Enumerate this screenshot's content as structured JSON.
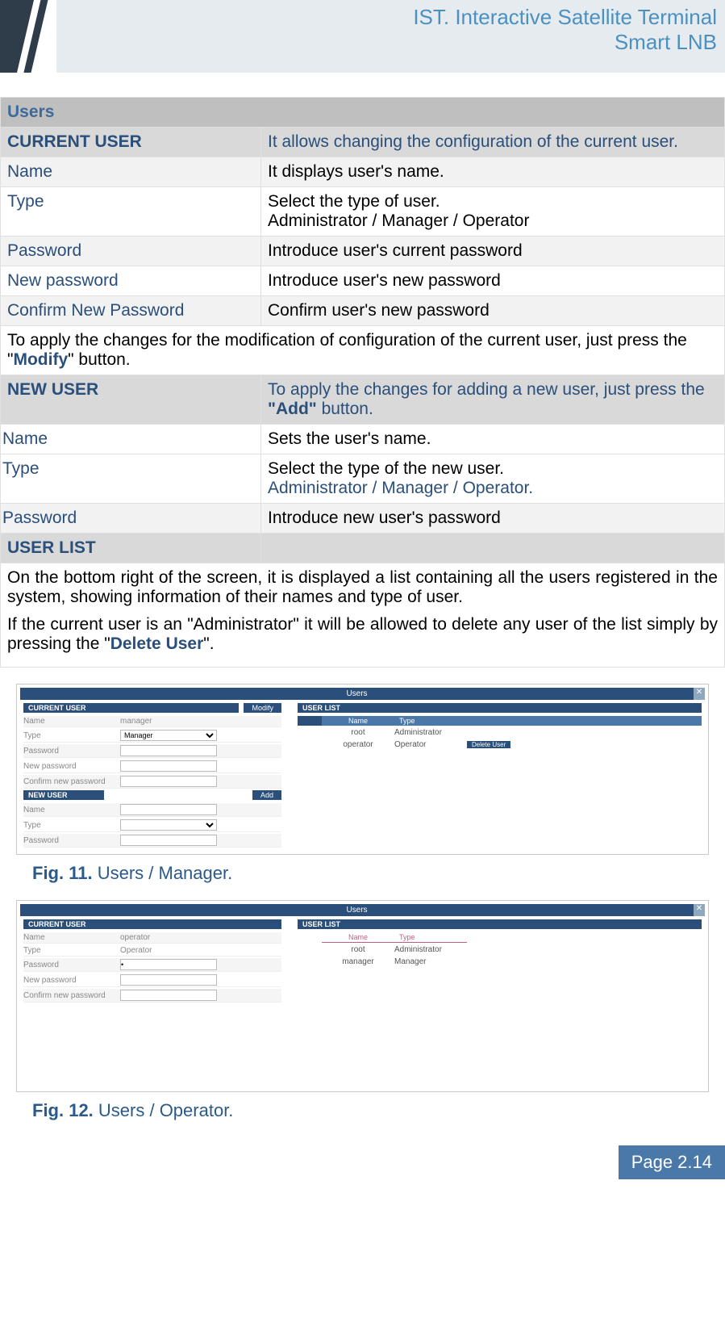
{
  "header": {
    "line1": "IST. Interactive Satellite Terminal",
    "line2": "Smart LNB"
  },
  "table": {
    "title": "Users",
    "current": {
      "label": "CURRENT USER",
      "desc": "It allows changing the configuration of the current user.",
      "rows": [
        {
          "k": "Name",
          "v": "It displays user's name."
        },
        {
          "k": "Type",
          "v": "Select the type of user.",
          "v2": "Administrator / Manager / Operator"
        },
        {
          "k": "Password",
          "v": "Introduce user's current password"
        },
        {
          "k": "New password",
          "v": "Introduce user's new password"
        },
        {
          "k": "Confirm New Password",
          "v": "Confirm user's new password"
        }
      ],
      "note_pre": "To apply the changes for the modification of configuration of the current user, just press the \"",
      "note_btn": "Modify",
      "note_post": "\" button."
    },
    "newuser": {
      "label": "NEW USER",
      "desc_pre": "To apply the changes for adding a new user, just press the ",
      "desc_btn": "\"Add\"",
      "desc_post": " button.",
      "rows": [
        {
          "k": "Name",
          "v": "Sets the user's name."
        },
        {
          "k": "Type",
          "v": "Select the type of the new user.",
          "v2": "Administrator / Manager / Operator."
        },
        {
          "k": "Password",
          "v": "Introduce new user's password"
        }
      ]
    },
    "userlist": {
      "label": "USER LIST",
      "p1": "On the bottom right of the screen, it is displayed a list containing all the users registered in the system, showing information of their names and type of user.",
      "p2_pre": "If the current user is an \"Administrator\" it will be allowed to delete any user of the list simply by pressing the \"",
      "p2_btn": "Delete User",
      "p2_post": "\"."
    }
  },
  "fig1": {
    "num": "Fig. 11.",
    "cap": " Users / Manager.",
    "ui": {
      "bar": "Users",
      "sec_current": "CURRENT USER",
      "btn_modify": "Modify",
      "sec_new": "NEW USER",
      "btn_add": "Add",
      "sec_list": "USER LIST",
      "lbl_name": "Name",
      "lbl_type": "Type",
      "lbl_pwd": "Password",
      "lbl_newpwd": "New password",
      "lbl_confpwd": "Confirm new password",
      "val_name": "manager",
      "val_type": "Manager",
      "list_h1": "Name",
      "list_h2": "Type",
      "btn_del": "Delete User",
      "rows": [
        {
          "n": "root",
          "t": "Administrator",
          "del": false
        },
        {
          "n": "operator",
          "t": "Operator",
          "del": true
        }
      ]
    }
  },
  "fig2": {
    "num": "Fig. 12.",
    "cap": " Users / Operator.",
    "ui": {
      "bar": "Users",
      "sec_current": "CURRENT USER",
      "sec_list": "USER LIST",
      "lbl_name": "Name",
      "lbl_type": "Type",
      "lbl_pwd": "Password",
      "lbl_newpwd": "New password",
      "lbl_confpwd": "Confirm new password",
      "val_name": "operator",
      "val_type": "Operator",
      "list_h1": "Name",
      "list_h2": "Type",
      "rows": [
        {
          "n": "root",
          "t": "Administrator"
        },
        {
          "n": "manager",
          "t": "Manager"
        }
      ]
    }
  },
  "footer": {
    "page": "Page 2.14"
  }
}
